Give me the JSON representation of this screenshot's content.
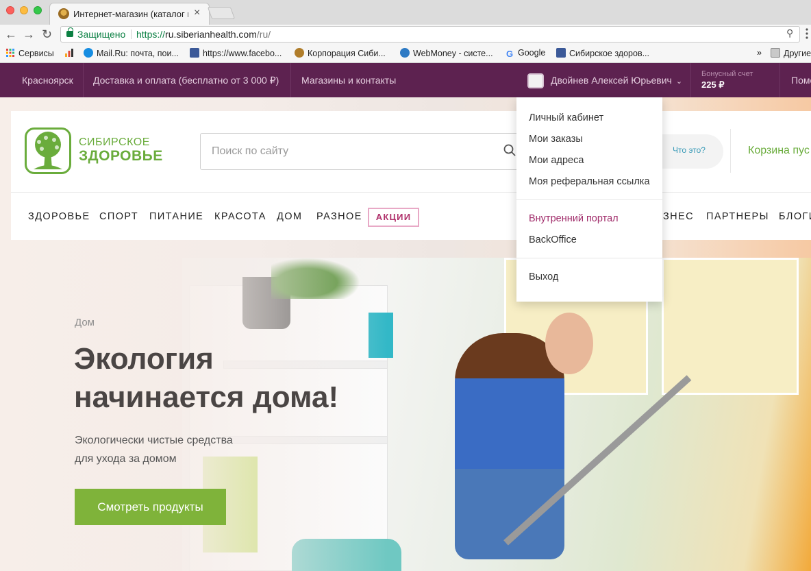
{
  "browser": {
    "tab_title": "Интернет-магазин (каталог п",
    "tab_close": "×",
    "secure_label": "Защищено",
    "url_scheme": "https://",
    "url_host": "ru.siberianhealth.com",
    "url_path": "/ru/",
    "bookmarks": [
      {
        "label": "Сервисы",
        "icon": "apps-grid-icon"
      },
      {
        "label": "",
        "icon": "bar-chart-bookmark-icon"
      },
      {
        "label": "Mail.Ru: почта, пои...",
        "icon": "mailru-icon"
      },
      {
        "label": "https://www.facebo...",
        "icon": "facebook-icon"
      },
      {
        "label": "Корпорация Сиби...",
        "icon": "siberian-health-icon"
      },
      {
        "label": "WebMoney - систе...",
        "icon": "webmoney-icon"
      },
      {
        "label": "Google",
        "icon": "google-icon"
      },
      {
        "label": "Сибирское здоров...",
        "icon": "facebook-icon"
      },
      {
        "label": "»",
        "icon": ""
      },
      {
        "label": "Другие",
        "icon": "folder-icon"
      }
    ]
  },
  "topbar": {
    "city": "Красноярск",
    "delivery": "Доставка и оплата (бесплатно от 3 000 ₽)",
    "stores": "Магазины и контакты",
    "user_name": "Двойнев Алексей Юрьевич",
    "bonus_label": "Бонусный счет",
    "bonus_value": "225 ₽",
    "help_cut": "Помо"
  },
  "header": {
    "logo_line1": "СИБИРСКОЕ",
    "logo_line2": "ЗДОРОВЬЕ",
    "search_placeholder": "Поиск по сайту",
    "whatis": "Что это?",
    "cart": "Корзина пус"
  },
  "nav": {
    "items": [
      "ЗДОРОВЬЕ",
      "СПОРТ",
      "ПИТАНИЕ",
      "КРАСОТА",
      "ДОМ",
      "РАЗНОЕ"
    ],
    "promo": "АКЦИИ",
    "right_items": [
      "ЗНЕС",
      "ПАРТНЕРЫ",
      "БЛОГИ"
    ]
  },
  "hero": {
    "tag": "Дом",
    "title_line1": "Экология",
    "title_line2": "начинается дома!",
    "subtitle_line1": "Экологически чистые средства",
    "subtitle_line2": "для ухода за домом",
    "button": "Смотреть продукты"
  },
  "dropdown": {
    "group1": [
      "Личный кабинет",
      "Мои заказы",
      "Мои адреса",
      "Моя реферальная ссылка"
    ],
    "group2": [
      "Внутренний портал",
      "BackOffice"
    ],
    "logout": "Выход"
  },
  "colors": {
    "topbar": "#5d2250",
    "brand_green": "#6aac3c",
    "button_green": "#7fb33a",
    "accent": "#a02c6a"
  }
}
